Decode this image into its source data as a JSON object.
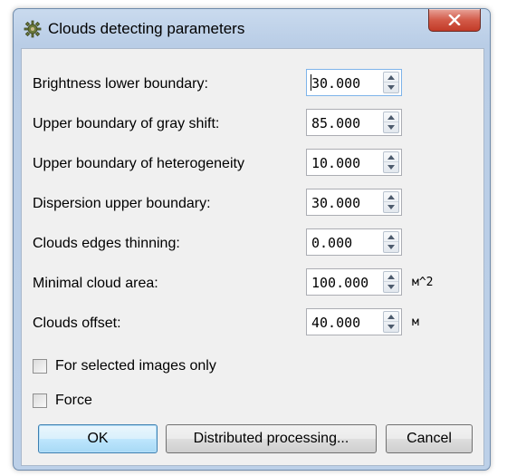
{
  "window": {
    "title": "Clouds detecting parameters",
    "close_label": "x"
  },
  "fields": [
    {
      "label": "Brightness lower boundary:",
      "value": "30.000",
      "unit": ""
    },
    {
      "label": "Upper boundary of gray shift:",
      "value": "85.000",
      "unit": ""
    },
    {
      "label": "Upper boundary of heterogeneity",
      "value": "10.000",
      "unit": ""
    },
    {
      "label": "Dispersion upper boundary:",
      "value": "30.000",
      "unit": ""
    },
    {
      "label": "Clouds edges thinning:",
      "value": "0.000",
      "unit": ""
    },
    {
      "label": "Minimal cloud area:",
      "value": "100.000",
      "unit": "м^2"
    },
    {
      "label": "Clouds offset:",
      "value": "40.000",
      "unit": "м"
    }
  ],
  "checkboxes": [
    {
      "label": "For selected images only",
      "checked": false
    },
    {
      "label": "Force",
      "checked": false
    }
  ],
  "buttons": {
    "ok": "OK",
    "distributed": "Distributed processing...",
    "cancel": "Cancel"
  },
  "icons": {
    "app": "cloud-gear-icon",
    "close": "close-icon",
    "spin_up": "arrow-up-icon",
    "spin_down": "arrow-down-icon"
  }
}
